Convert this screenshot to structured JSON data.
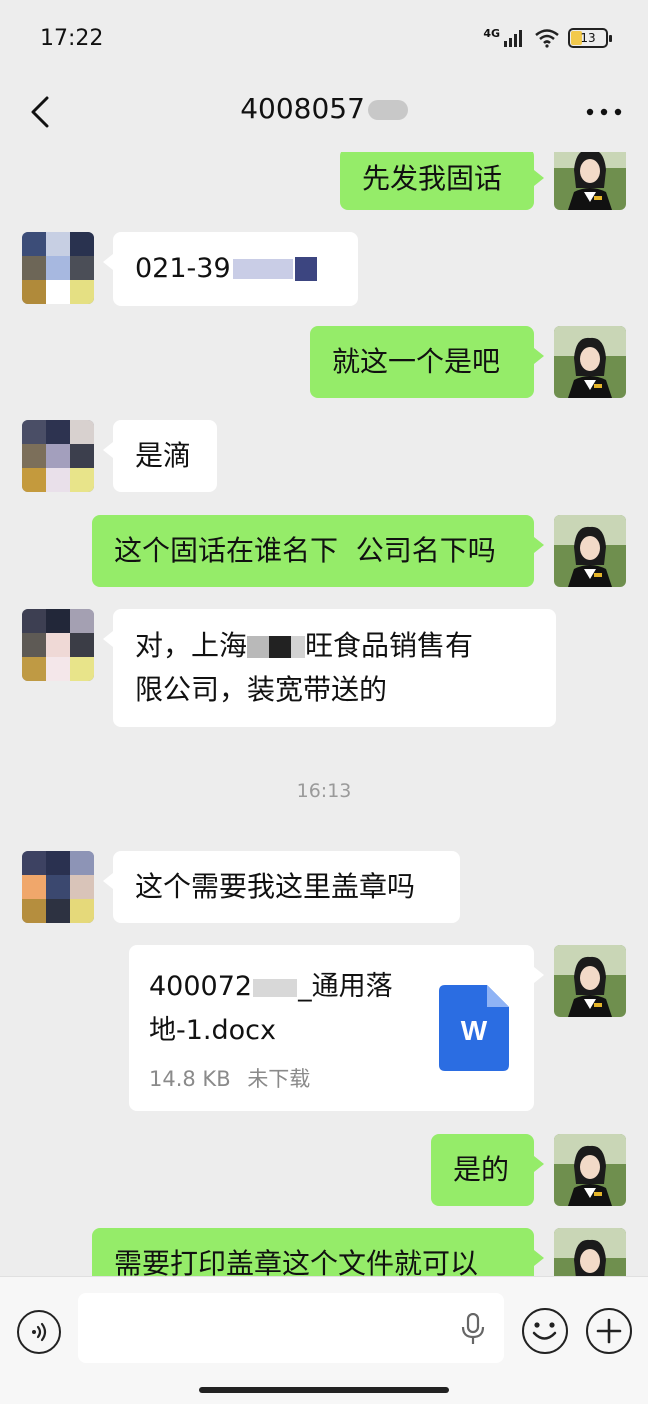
{
  "status_bar": {
    "time": "17:22",
    "network": "4G",
    "battery": "13"
  },
  "header": {
    "title": "4008057"
  },
  "messages": [
    {
      "side": "right",
      "text": "先发我固话"
    },
    {
      "side": "left",
      "text": "021-39"
    },
    {
      "side": "right",
      "text": "就这一个是吧"
    },
    {
      "side": "left",
      "text": "是滴"
    },
    {
      "side": "right",
      "text": "这个固话在谁名下  公司名下吗"
    },
    {
      "side": "left",
      "line1_a": "对，上海",
      "line1_b": "旺食品销售有",
      "line2": "限公司，装宽带送的"
    },
    {
      "side": "left",
      "text": "这个需要我这里盖章吗"
    },
    {
      "side": "right",
      "text": "是的"
    },
    {
      "side": "right",
      "text": "需要打印盖章这个文件就可以"
    }
  ],
  "timestamp": "16:13",
  "file": {
    "name_line1": "400072",
    "name_line1_tail": "_通用落",
    "name_line2": "地-1.docx",
    "size": "14.8 KB",
    "status": "未下载",
    "icon_letter": "W"
  },
  "input": {
    "placeholder": ""
  },
  "icons": [
    "back-icon",
    "more-icon",
    "voice-icon",
    "mic-icon",
    "emoji-icon",
    "plus-icon",
    "word-doc-icon"
  ],
  "colors": {
    "background": "#ededed",
    "my_bubble": "#95ec69",
    "their_bubble": "#ffffff",
    "word_blue": "#2b6de2"
  }
}
